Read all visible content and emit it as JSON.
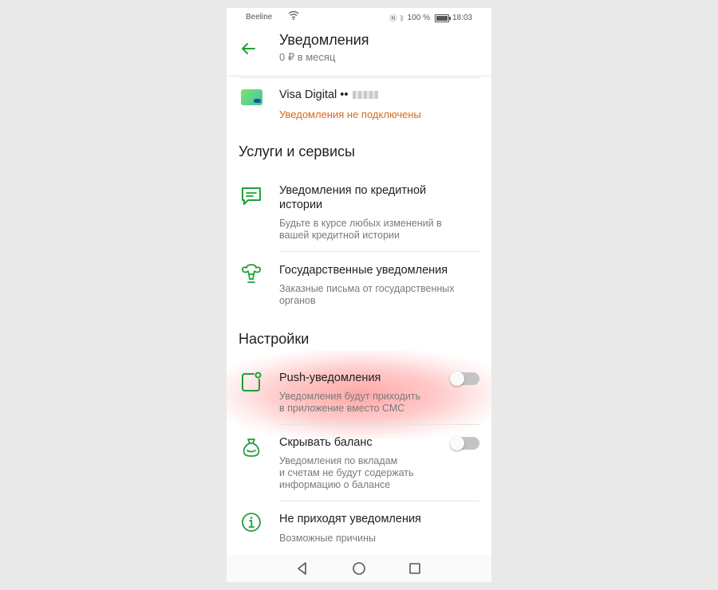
{
  "status_bar": {
    "carrier": "Beeline",
    "battery": "100 %",
    "time": "18:03",
    "battery_level": 1.0
  },
  "header": {
    "title": "Уведомления",
    "subtitle": "0 ₽ в месяц",
    "back_icon": "arrow-left-icon"
  },
  "card": {
    "name": "Visa Digital ••",
    "status": "Уведомления не подключены",
    "icon": "bank-card-icon"
  },
  "services": {
    "heading": "Услуги и сервисы",
    "items": [
      {
        "title_lines": [
          "Уведомления по кредитной",
          "истории"
        ],
        "desc_lines": [
          "Будьте в курсе любых изменений в",
          "вашей кредитной истории"
        ],
        "icon": "message-icon"
      },
      {
        "title_lines": [
          "Государственные уведомления"
        ],
        "desc_lines": [
          "Заказные письма от государственных",
          "органов"
        ],
        "icon": "state-emblem-icon"
      }
    ]
  },
  "settings": {
    "heading": "Настройки",
    "items": [
      {
        "title_lines": [
          "Push-уведомления"
        ],
        "desc_lines": [
          "Уведомления будут приходить",
          "в приложение вместо СМС"
        ],
        "icon": "push-notification-icon",
        "toggle_on": false
      },
      {
        "title_lines": [
          "Скрывать баланс"
        ],
        "desc_lines": [
          "Уведомления по вкладам",
          "и счетам не будут содержать",
          "информацию о балансе"
        ],
        "icon": "money-bag-icon",
        "toggle_on": false
      },
      {
        "title_lines": [
          "Не приходят уведомления"
        ],
        "desc_lines": [
          "Возможные причины"
        ],
        "icon": "info-icon"
      }
    ]
  },
  "nav_bar": {
    "icons": [
      "back-triangle-icon",
      "home-circle-icon",
      "recents-square-icon"
    ]
  },
  "colors": {
    "accent": "#21a038",
    "warning": "#d66a1c",
    "highlight": "#ff3c3c",
    "toggle_track_off": "#c4c4c4"
  }
}
